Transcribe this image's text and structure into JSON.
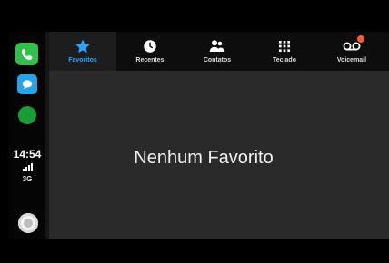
{
  "sidebar": {
    "time": "14:54",
    "network": "3G",
    "apps": [
      {
        "name": "phone-icon"
      },
      {
        "name": "messages-icon"
      },
      {
        "name": "music-icon"
      }
    ]
  },
  "tabs": [
    {
      "label": "Favoritos",
      "icon": "star-icon",
      "active": true
    },
    {
      "label": "Recentes",
      "icon": "clock-icon",
      "active": false
    },
    {
      "label": "Contatos",
      "icon": "contacts-icon",
      "active": false
    },
    {
      "label": "Teclado",
      "icon": "keypad-icon",
      "active": false
    },
    {
      "label": "Voicemail",
      "icon": "voicemail-icon",
      "active": false
    }
  ],
  "main": {
    "empty_message": "Nenhum Favorito"
  },
  "colors": {
    "accent": "#2aa3ff",
    "background": "#2a2a2a",
    "tabbar": "#0d0d0d",
    "badge": "#ff5a36"
  }
}
